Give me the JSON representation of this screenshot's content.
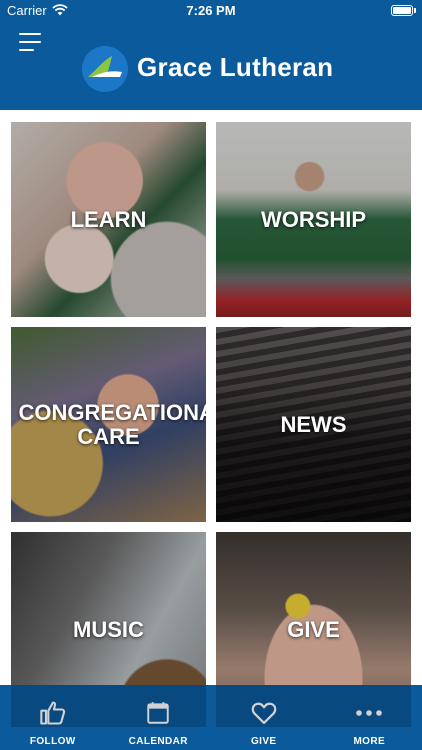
{
  "status_bar": {
    "carrier": "Carrier",
    "time": "7:26 PM"
  },
  "header": {
    "title": "Grace Lutheran",
    "menu_icon": "hamburger-menu-icon",
    "logo_icon": "grace-lutheran-logo"
  },
  "colors": {
    "brand_blue": "#0a5a9c",
    "logo_green": "#8cc63f",
    "text": "#ffffff"
  },
  "tiles": [
    {
      "label": "LEARN"
    },
    {
      "label": "WORSHIP"
    },
    {
      "label": "CONGREGATIONAL CARE"
    },
    {
      "label": "NEWS"
    },
    {
      "label": "MUSIC"
    },
    {
      "label": "GIVE"
    }
  ],
  "tabbar": {
    "items": [
      {
        "label": "FOLLOW",
        "icon": "thumbs-up-icon"
      },
      {
        "label": "CALENDAR",
        "icon": "calendar-icon"
      },
      {
        "label": "GIVE",
        "icon": "heart-icon"
      },
      {
        "label": "MORE",
        "icon": "more-dots-icon"
      }
    ]
  }
}
